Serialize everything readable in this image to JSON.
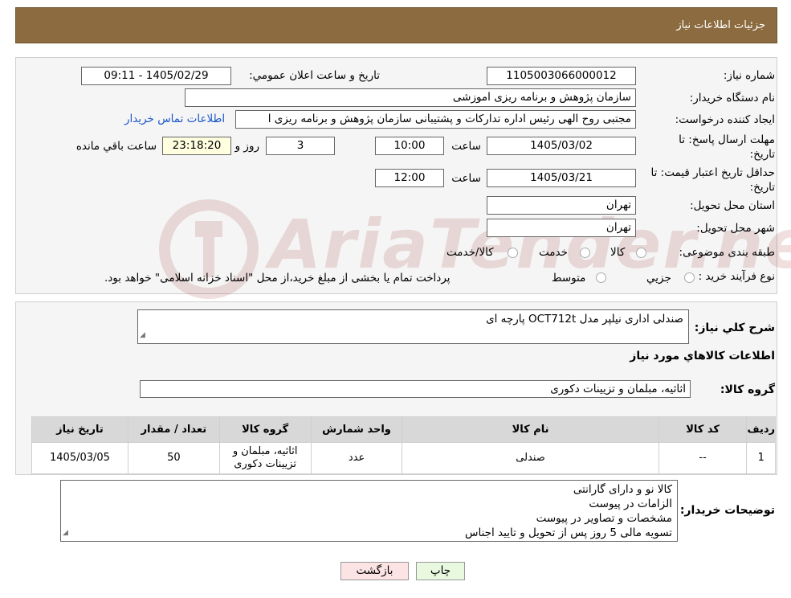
{
  "header": {
    "title": "جزئیات اطلاعات نیاز"
  },
  "form": {
    "need_number_label": "شماره نیاز:",
    "need_number": "1105003066000012",
    "announce_label": "تاریخ و ساعت اعلان عمومي:",
    "announce_value": "1405/02/29 - 09:11",
    "buyer_org_label": "نام دستگاه خریدار:",
    "buyer_org": "سازمان پژوهش و برنامه ریزی اموزشی",
    "creator_label": "ایجاد کننده درخواست:",
    "creator": "مجتبی روح الهی رئیس اداره تدارکات و پشتیبانی سازمان پژوهش و برنامه ریزی ا",
    "contact_link": "اطلاعات تماس خریدار",
    "deadline_label_line1": "مهلت ارسال پاسخ: تا",
    "deadline_label_line2": "تاریخ:",
    "deadline_date": "1405/03/02",
    "time_label": "ساعت",
    "deadline_time": "10:00",
    "days_value": "3",
    "days_label": "روز و",
    "remaining_time": "23:18:20",
    "remaining_label": "ساعت باقي مانده",
    "validity_label_line1": "حداقل تاریخ اعتبار قیمت: تا",
    "validity_label_line2": "تاریخ:",
    "validity_date": "1405/03/21",
    "validity_time": "12:00",
    "province_label": "استان محل تحویل:",
    "province": "تهران",
    "city_label": "شهر محل تحویل:",
    "city": "تهران",
    "category_label": "طبقه بندی موضوعی:",
    "category_options": [
      "کالا",
      "خدمت",
      "کالا/خدمت"
    ],
    "purchase_type_label": "نوع فرآیند خرید :",
    "purchase_options": [
      "جزيي",
      "متوسط"
    ],
    "purchase_note": "پرداخت تمام یا بخشی از مبلغ خرید،از محل \"اسناد خزانه اسلامی\" خواهد بود."
  },
  "details": {
    "description_label": "شرح کلي نياز:",
    "description": "صندلی اداری نیلپر مدل OCT712t پارچه ای",
    "goods_info_title": "اطلاعات کالاهاي مورد نياز",
    "goods_group_label": "گروه کالا:",
    "goods_group": "اثاثیه، مبلمان و تزیینات دکوری"
  },
  "table": {
    "headers": [
      "رديف",
      "کد کالا",
      "نام کالا",
      "واحد شمارش",
      "گروه کالا",
      "تعداد / مقدار",
      "تاریخ نیاز"
    ],
    "rows": [
      [
        "1",
        "--",
        "صندلی",
        "عدد",
        "اثاثیه، مبلمان و تزیینات دکوری",
        "50",
        "1405/03/05"
      ]
    ]
  },
  "buyer_notes": {
    "label": "توضیحات خریدار:",
    "lines": [
      "کالا نو و دارای گارانتی",
      "الزامات در پیوست",
      "مشخصات و تصاویر در پیوست",
      "تسویه مالی 5 روز پس از تحویل و تایید اجناس"
    ]
  },
  "buttons": {
    "print": "چاپ",
    "back": "بازگشت"
  },
  "watermark": {
    "text": "AriaTender.neT"
  },
  "colors": {
    "header_bg": "#8B6B3F",
    "link": "#1a56c8",
    "back_button_bg": "#fde4e4",
    "print_button_bg": "#e8f9e0"
  }
}
